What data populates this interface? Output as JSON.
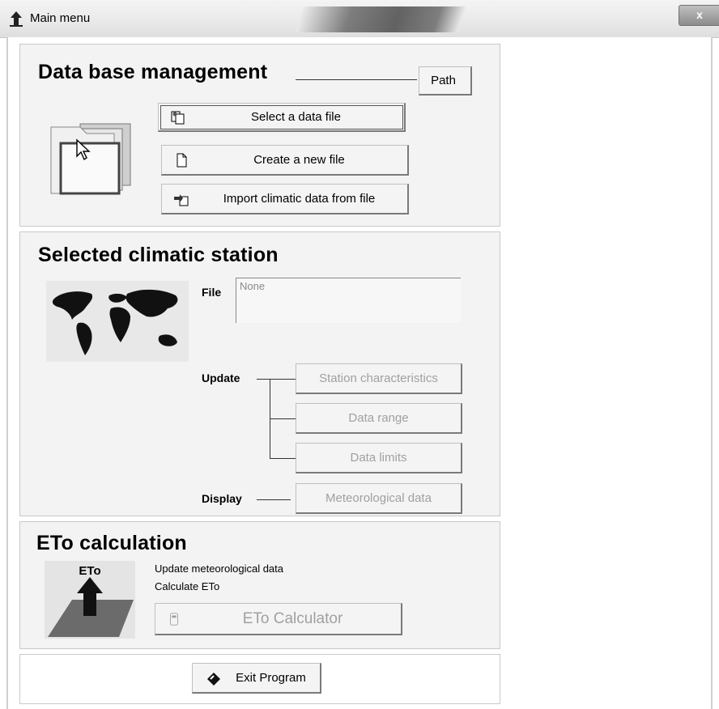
{
  "window": {
    "title": "Main menu",
    "close_label": "x"
  },
  "database": {
    "heading": "Data base management",
    "path_label": "Path",
    "select_label": "Select a data file",
    "create_label": "Create a new file",
    "import_label": "Import climatic data from file"
  },
  "station": {
    "heading": "Selected climatic station",
    "file_label": "File",
    "file_value": "None",
    "update_label": "Update",
    "characteristics_label": "Station characteristics",
    "range_label": "Data range",
    "limits_label": "Data limits",
    "display_label": "Display",
    "meteo_label": "Meteorological data"
  },
  "eto": {
    "heading": "ETo calculation",
    "image_label": "ETo",
    "note_1": "Update meteorological data",
    "note_2": "Calculate ETo",
    "calculator_label": "ETo Calculator"
  },
  "exit": {
    "label": "Exit Program"
  }
}
